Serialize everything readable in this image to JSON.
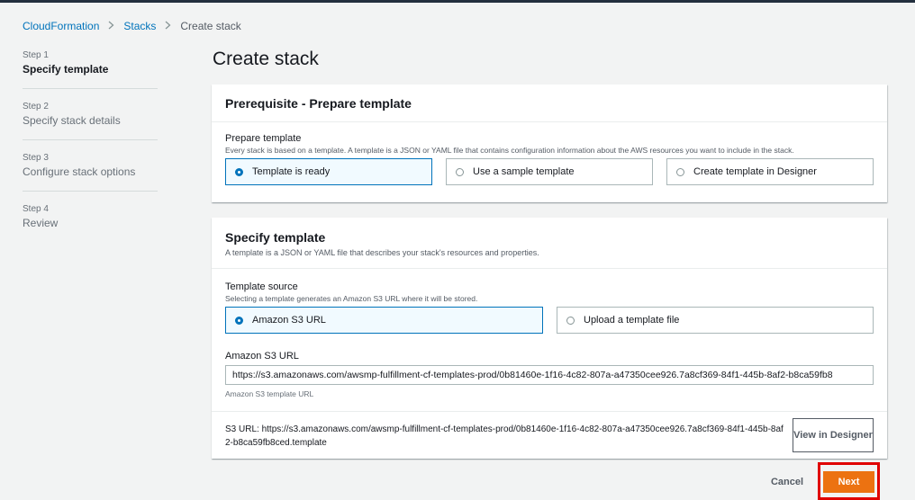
{
  "breadcrumb": {
    "items": [
      "CloudFormation",
      "Stacks"
    ],
    "current": "Create stack"
  },
  "steps": [
    {
      "num": "Step 1",
      "title": "Specify template",
      "active": true
    },
    {
      "num": "Step 2",
      "title": "Specify stack details",
      "active": false
    },
    {
      "num": "Step 3",
      "title": "Configure stack options",
      "active": false
    },
    {
      "num": "Step 4",
      "title": "Review",
      "active": false
    }
  ],
  "page_title": "Create stack",
  "prereq": {
    "title": "Prerequisite - Prepare template",
    "field_label": "Prepare template",
    "field_desc": "Every stack is based on a template. A template is a JSON or YAML file that contains configuration information about the AWS resources you want to include in the stack.",
    "options": [
      "Template is ready",
      "Use a sample template",
      "Create template in Designer"
    ],
    "selected": "Template is ready"
  },
  "specify": {
    "title": "Specify template",
    "desc": "A template is a JSON or YAML file that describes your stack's resources and properties.",
    "source_label": "Template source",
    "source_desc": "Selecting a template generates an Amazon S3 URL where it will be stored.",
    "source_options": [
      "Amazon S3 URL",
      "Upload a template file"
    ],
    "source_selected": "Amazon S3 URL",
    "s3_label": "Amazon S3 URL",
    "s3_value": "https://s3.amazonaws.com/awsmp-fulfillment-cf-templates-prod/0b81460e-1f16-4c82-807a-a47350cee926.7a8cf369-84f1-445b-8af2-b8ca59fb8",
    "s3_constraint": "Amazon S3 template URL",
    "s3_url_line": "S3 URL:  https://s3.amazonaws.com/awsmp-fulfillment-cf-templates-prod/0b81460e-1f16-4c82-807a-a47350cee926.7a8cf369-84f1-445b-8af2-b8ca59fb8ced.template",
    "view_designer_label": "View in Designer"
  },
  "actions": {
    "cancel_label": "Cancel",
    "next_label": "Next"
  },
  "colors": {
    "accent": "#0073bb",
    "primary_button": "#ec7211",
    "highlight": "#e00000"
  }
}
